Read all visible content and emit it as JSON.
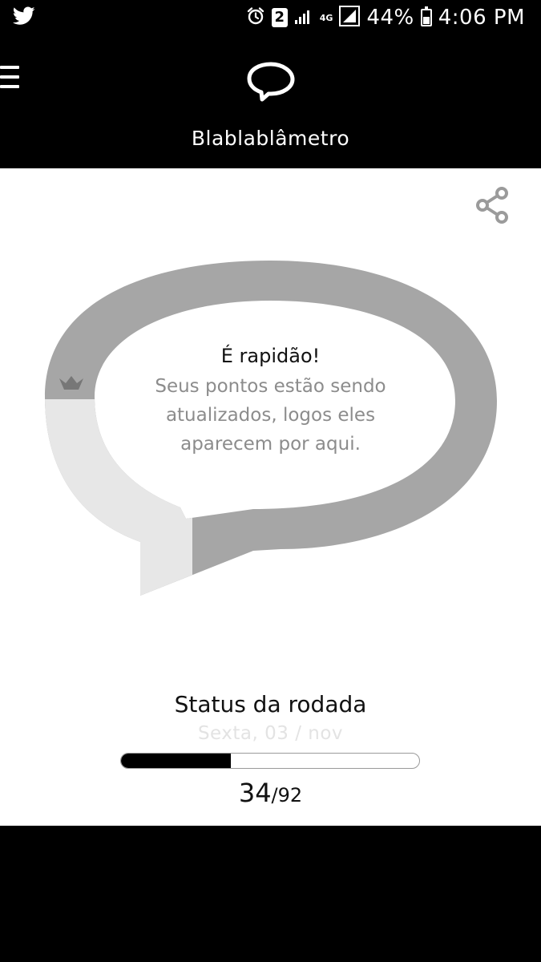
{
  "status_bar": {
    "time": "4:06 PM",
    "battery": "44%",
    "sim_slot": "2",
    "network": "4G",
    "icons": [
      "twitter-icon",
      "alarm-icon",
      "signal-icon",
      "battery-icon"
    ]
  },
  "header": {
    "title": "Blablablâmetro"
  },
  "meter": {
    "message_title": "É rapidão!",
    "message_body": "Seus pontos estão sendo atualizados, logos eles aparecem por aqui."
  },
  "round_status": {
    "title": "Status da rodada",
    "date": "Sexta, 03 / nov",
    "completed": "34",
    "total": "/92",
    "progress_fraction": 0.3696
  },
  "colors": {
    "background": "#000000",
    "card": "#ffffff",
    "bubble_dark": "#a6a6a6",
    "bubble_light": "#e7e7e7",
    "progress_fill": "#000000"
  }
}
